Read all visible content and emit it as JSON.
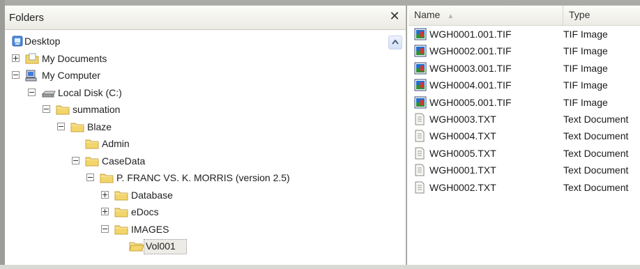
{
  "folders_pane": {
    "title": "Folders",
    "close_glyph": "✕",
    "tree": [
      {
        "label": "Desktop",
        "icon": "desktop-icon",
        "expander": "none"
      },
      {
        "label": "My Documents",
        "icon": "my-documents-icon",
        "expander": "plus"
      },
      {
        "label": "My Computer",
        "icon": "my-computer-icon",
        "expander": "minus"
      },
      {
        "label": "Local Disk (C:)",
        "icon": "hard-disk-icon",
        "expander": "minus"
      },
      {
        "label": "summation",
        "icon": "folder-icon",
        "expander": "minus"
      },
      {
        "label": "Blaze",
        "icon": "folder-icon",
        "expander": "minus"
      },
      {
        "label": "Admin",
        "icon": "folder-icon",
        "expander": "none"
      },
      {
        "label": "CaseData",
        "icon": "folder-icon",
        "expander": "minus"
      },
      {
        "label": "P. FRANC VS. K. MORRIS (version 2.5)",
        "icon": "folder-icon",
        "expander": "minus"
      },
      {
        "label": "Database",
        "icon": "folder-icon",
        "expander": "plus"
      },
      {
        "label": "eDocs",
        "icon": "folder-icon",
        "expander": "plus"
      },
      {
        "label": "IMAGES",
        "icon": "folder-icon",
        "expander": "minus"
      },
      {
        "label": "Vol001",
        "icon": "folder-open-icon",
        "expander": "none",
        "selected": true
      }
    ]
  },
  "files_pane": {
    "columns": {
      "name": "Name",
      "type": "Type"
    },
    "sort": "ascending",
    "files": [
      {
        "name": "WGH0001.001.TIF",
        "type": "TIF Image",
        "icon": "tif-image-icon"
      },
      {
        "name": "WGH0002.001.TIF",
        "type": "TIF Image",
        "icon": "tif-image-icon"
      },
      {
        "name": "WGH0003.001.TIF",
        "type": "TIF Image",
        "icon": "tif-image-icon"
      },
      {
        "name": "WGH0004.001.TIF",
        "type": "TIF Image",
        "icon": "tif-image-icon"
      },
      {
        "name": "WGH0005.001.TIF",
        "type": "TIF Image",
        "icon": "tif-image-icon"
      },
      {
        "name": "WGH0003.TXT",
        "type": "Text Document",
        "icon": "text-document-icon"
      },
      {
        "name": "WGH0004.TXT",
        "type": "Text Document",
        "icon": "text-document-icon"
      },
      {
        "name": "WGH0005.TXT",
        "type": "Text Document",
        "icon": "text-document-icon"
      },
      {
        "name": "WGH0001.TXT",
        "type": "Text Document",
        "icon": "text-document-icon"
      },
      {
        "name": "WGH0002.TXT",
        "type": "Text Document",
        "icon": "text-document-icon"
      }
    ]
  },
  "colors": {
    "folder": "#f3d66b",
    "folder_edge": "#c9a13a",
    "selection_fill": "#ecebe6",
    "header_bg": "#ecebe4",
    "frame": "#a8a8a4"
  }
}
